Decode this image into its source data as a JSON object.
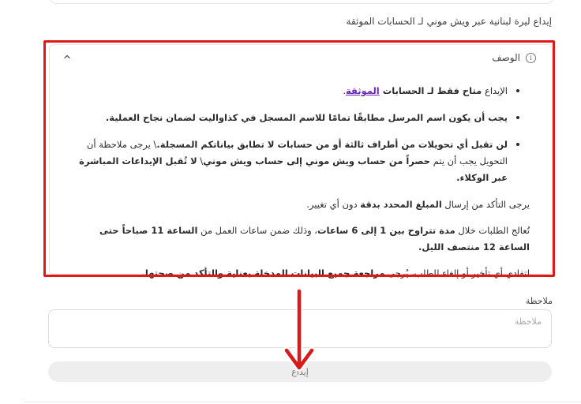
{
  "subtitle": "إيداع ليرة لبنانية عبر ويش موني لـ الحسابات الموثقة",
  "accordion": {
    "title": "الوصف",
    "info_icon": "i",
    "chevron": "chevron-up-icon"
  },
  "content": {
    "b1": {
      "pre": "الإيداع ",
      "bold": "متاح فقط لـ الحسابات ",
      "link": "الموثقة",
      "post": "."
    },
    "b2": "يجب أن يكون اسم المرسل مطابقًا تمامًا للاسم المسجل في كذاواليت لضمان نجاح العملية.",
    "b3": {
      "bold1": "لن تقبل أي تحويلات من أطراف ثالثة أو من حسابات لا تطابق بياناتكم المسجلة.",
      "normal1": "\\ يرجى ملاحظة أن التحويل يجب أن يتم ",
      "bold2": "حصراً من حساب ويش موني إلى حساب ويش موني",
      "normal2": "\\ ",
      "bold3": "لا تُقبل الإيداعات المباشرة عبر الوكلاء."
    },
    "p1": {
      "pre": "يرجى التأكد من إرسال ",
      "bold": "المبلغ المحدد بدقة",
      "post": " دون أي تغيير."
    },
    "p2": {
      "pre": "تُعالج الطلبات خلال ",
      "bold1": "مدة تتراوح بين 1 إلى 6 ساعات",
      "mid": "، وذلك ضمن ساعات العمل من ",
      "bold2": "الساعة 11 صباحاً حتى الساعة 12 منتصف الليل."
    },
    "p3": {
      "pre": "لتفادي أي تأخير أو إلغاء للطلب، يُرجى ",
      "bold": "مراجعة جميع البيانات المدخلة بعناية والتأكد من صحتها."
    }
  },
  "note": {
    "label": "ملاحظة",
    "placeholder": "ملاحظة",
    "value": ""
  },
  "submit": {
    "label": "إيداع"
  },
  "colors": {
    "highlight_box": "#e01818",
    "link": "#6a24b8",
    "button_bg": "#eeeeee"
  }
}
